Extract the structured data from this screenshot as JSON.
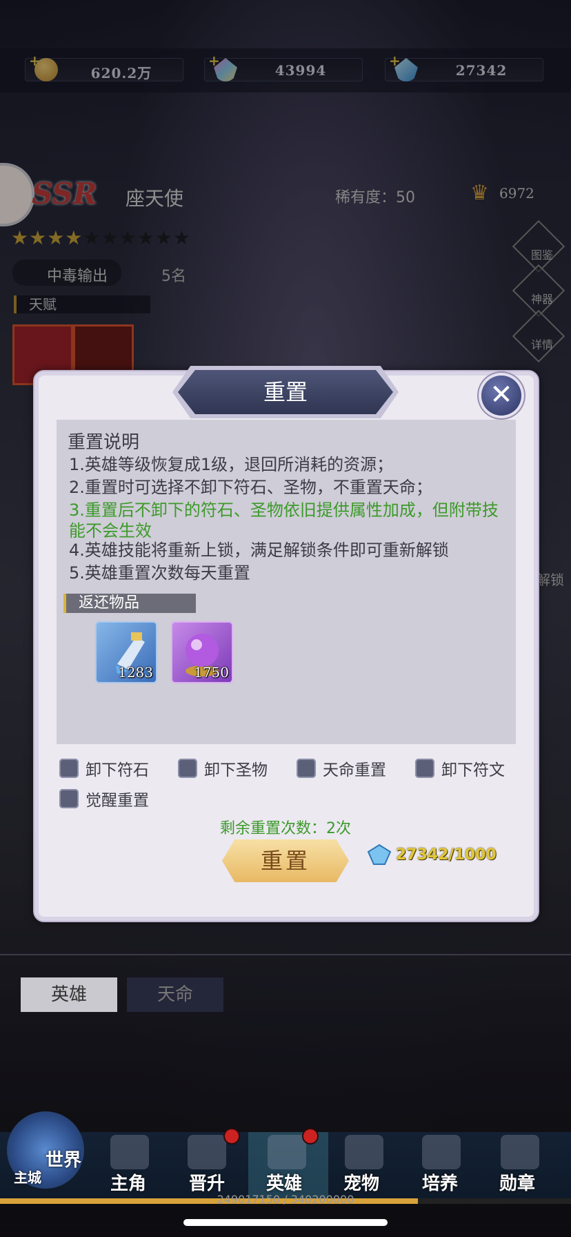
{
  "resources": [
    {
      "icon": "gold-coin-icon",
      "value": "620.2万"
    },
    {
      "icon": "rainbow-crystal-icon",
      "value": "43994"
    },
    {
      "icon": "blue-diamond-icon",
      "value": "27342"
    }
  ],
  "hero": {
    "grade": "SSR",
    "name": "座天使",
    "rarity_label": "稀有度：50",
    "power": "6972",
    "stars_filled": 4,
    "stars_total": 10,
    "role": "中毒输出",
    "rank": "5名",
    "talent_label": "天赋"
  },
  "side_buttons": [
    "图鉴",
    "神器",
    "详情"
  ],
  "side_extra_label": "解锁",
  "dialog": {
    "title": "重置",
    "section_title": "重置说明",
    "lines": [
      "1.英雄等级恢复成1级，退回所消耗的资源；",
      "2.重置时可选择不卸下符石、圣物，不重置天命；",
      "3.重置后不卸下的符石、圣物依旧提供属性加成，但附带技能不会生效",
      "4.英雄技能将重新上锁，满足解锁条件即可重新解锁",
      "5.英雄重置次数每天重置"
    ],
    "returns_title": "返还物品",
    "return_items": [
      {
        "icon": "potion-flask-icon",
        "count": "1283"
      },
      {
        "icon": "purple-orb-icon",
        "count": "1750"
      }
    ],
    "options": [
      "卸下符石",
      "卸下圣物",
      "天命重置",
      "卸下符文",
      "觉醒重置"
    ],
    "remaining": "剩余重置次数：2次",
    "reset_button": "重置",
    "cost": "27342/1000"
  },
  "tabs": [
    "英雄",
    "天命"
  ],
  "nav": {
    "world_label": "世界",
    "city_label": "主城",
    "items": [
      "主角",
      "晋升",
      "英雄",
      "宠物",
      "培养",
      "勋章"
    ],
    "active": "英雄",
    "xp_text": "249017150 / 340200000",
    "xp_fraction": 0.732
  },
  "colors": {
    "accent_green": "#3c9a2a",
    "gold": "#d8a23a",
    "badge_red": "#cc2222"
  }
}
